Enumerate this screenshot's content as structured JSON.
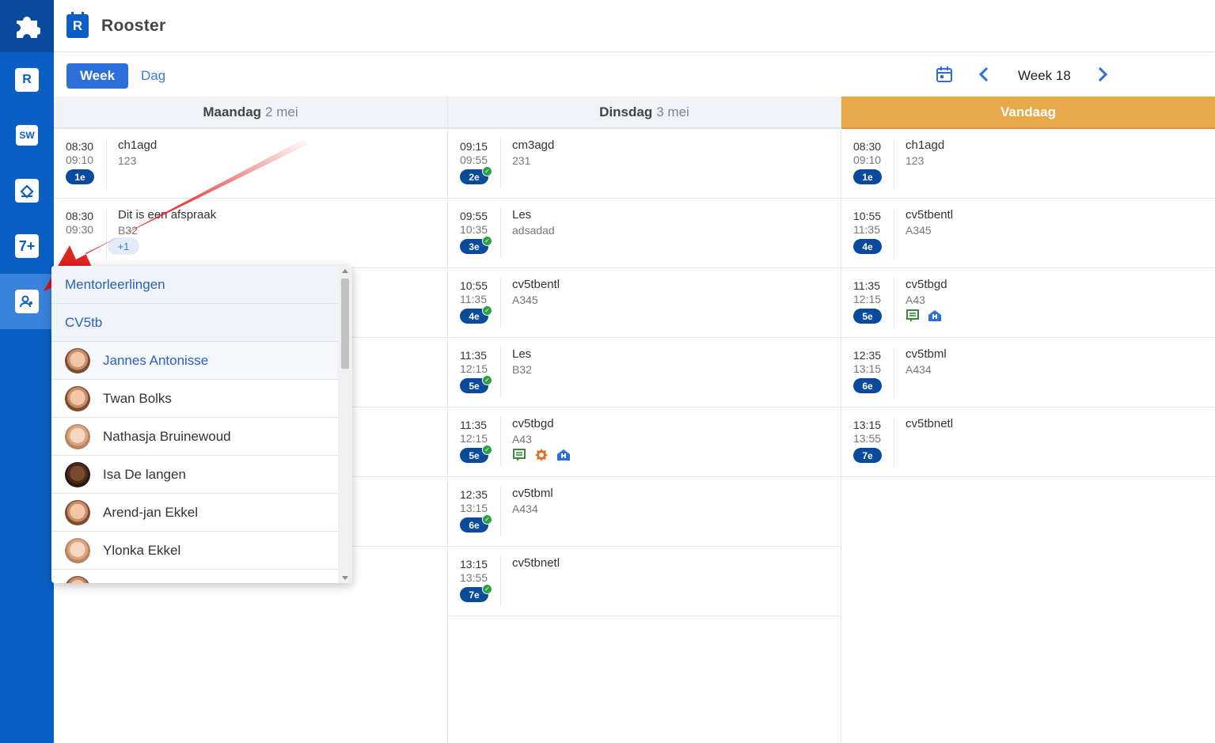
{
  "app": {
    "title": "Rooster",
    "icon_letter": "R"
  },
  "sidebar": {
    "items": [
      {
        "name": "rooster",
        "label": "R"
      },
      {
        "name": "sw",
        "label": "SW"
      },
      {
        "name": "edit",
        "label": ""
      },
      {
        "name": "seven-plus",
        "label": "7+"
      },
      {
        "name": "mentor",
        "label": ""
      }
    ]
  },
  "toolbar": {
    "week_tab": "Week",
    "day_tab": "Dag",
    "week_label": "Week 18"
  },
  "columns": [
    {
      "day": "Maandag",
      "date": "2 mei",
      "today": false,
      "lessons": [
        {
          "start": "08:30",
          "end": "09:10",
          "subject": "ch1agd",
          "room": "123",
          "hour": "1e",
          "check": false
        },
        {
          "start": "08:30",
          "end": "09:30",
          "subject": "Dit is een afspraak",
          "room": "B32",
          "hour": "",
          "plus": "+1"
        }
      ]
    },
    {
      "day": "Dinsdag",
      "date": "3 mei",
      "today": false,
      "lessons": [
        {
          "start": "09:15",
          "end": "09:55",
          "subject": "cm3agd",
          "room": "231",
          "hour": "2e",
          "check": true
        },
        {
          "start": "09:55",
          "end": "10:35",
          "subject": "Les",
          "room": "adsadad",
          "hour": "3e",
          "check": true
        },
        {
          "start": "10:55",
          "end": "11:35",
          "subject": "cv5tbentl",
          "room": "A345",
          "hour": "4e",
          "check": true
        },
        {
          "start": "11:35",
          "end": "12:15",
          "subject": "Les",
          "room": "B32",
          "hour": "5e",
          "check": true
        },
        {
          "start": "11:35",
          "end": "12:15",
          "subject": "cv5tbgd",
          "room": "A43",
          "hour": "5e",
          "check": true,
          "icons": [
            "homework-icon",
            "test-icon",
            "school-icon"
          ]
        },
        {
          "start": "12:35",
          "end": "13:15",
          "subject": "cv5tbml",
          "room": "A434",
          "hour": "6e",
          "check": true
        },
        {
          "start": "13:15",
          "end": "13:55",
          "subject": "cv5tbnetl",
          "room": "",
          "hour": "7e",
          "check": true
        }
      ]
    },
    {
      "day": "Vandaag",
      "date": "",
      "today": true,
      "lessons": [
        {
          "start": "08:30",
          "end": "09:10",
          "subject": "ch1agd",
          "room": "123",
          "hour": "1e",
          "check": false
        },
        {
          "start": "10:55",
          "end": "11:35",
          "subject": "cv5tbentl",
          "room": "A345",
          "hour": "4e",
          "check": false
        },
        {
          "start": "11:35",
          "end": "12:15",
          "subject": "cv5tbgd",
          "room": "A43",
          "hour": "5e",
          "check": false,
          "icons": [
            "homework-icon",
            "school-icon"
          ]
        },
        {
          "start": "12:35",
          "end": "13:15",
          "subject": "cv5tbml",
          "room": "A434",
          "hour": "6e",
          "check": false
        },
        {
          "start": "13:15",
          "end": "13:55",
          "subject": "cv5tbnetl",
          "room": "",
          "hour": "7e",
          "check": false
        }
      ]
    }
  ],
  "dropdown": {
    "header": "Mentorleerlingen",
    "group": "CV5tb",
    "students": [
      {
        "name": "Jannes Antonisse",
        "highlight": true,
        "skin": "medium"
      },
      {
        "name": "Twan Bolks",
        "highlight": false,
        "skin": "medium"
      },
      {
        "name": "Nathasja Bruinewoud",
        "highlight": false,
        "skin": "light"
      },
      {
        "name": "Isa De langen",
        "highlight": false,
        "skin": "dark"
      },
      {
        "name": "Arend-jan Ekkel",
        "highlight": false,
        "skin": "medium"
      },
      {
        "name": "Ylonka Ekkel",
        "highlight": false,
        "skin": "light"
      },
      {
        "name": "",
        "highlight": false,
        "skin": "medium"
      }
    ]
  },
  "colors": {
    "primary": "#0b5fc4",
    "today": "#e8a94a",
    "arrow": "#e52222",
    "check": "#2e9d4a"
  }
}
